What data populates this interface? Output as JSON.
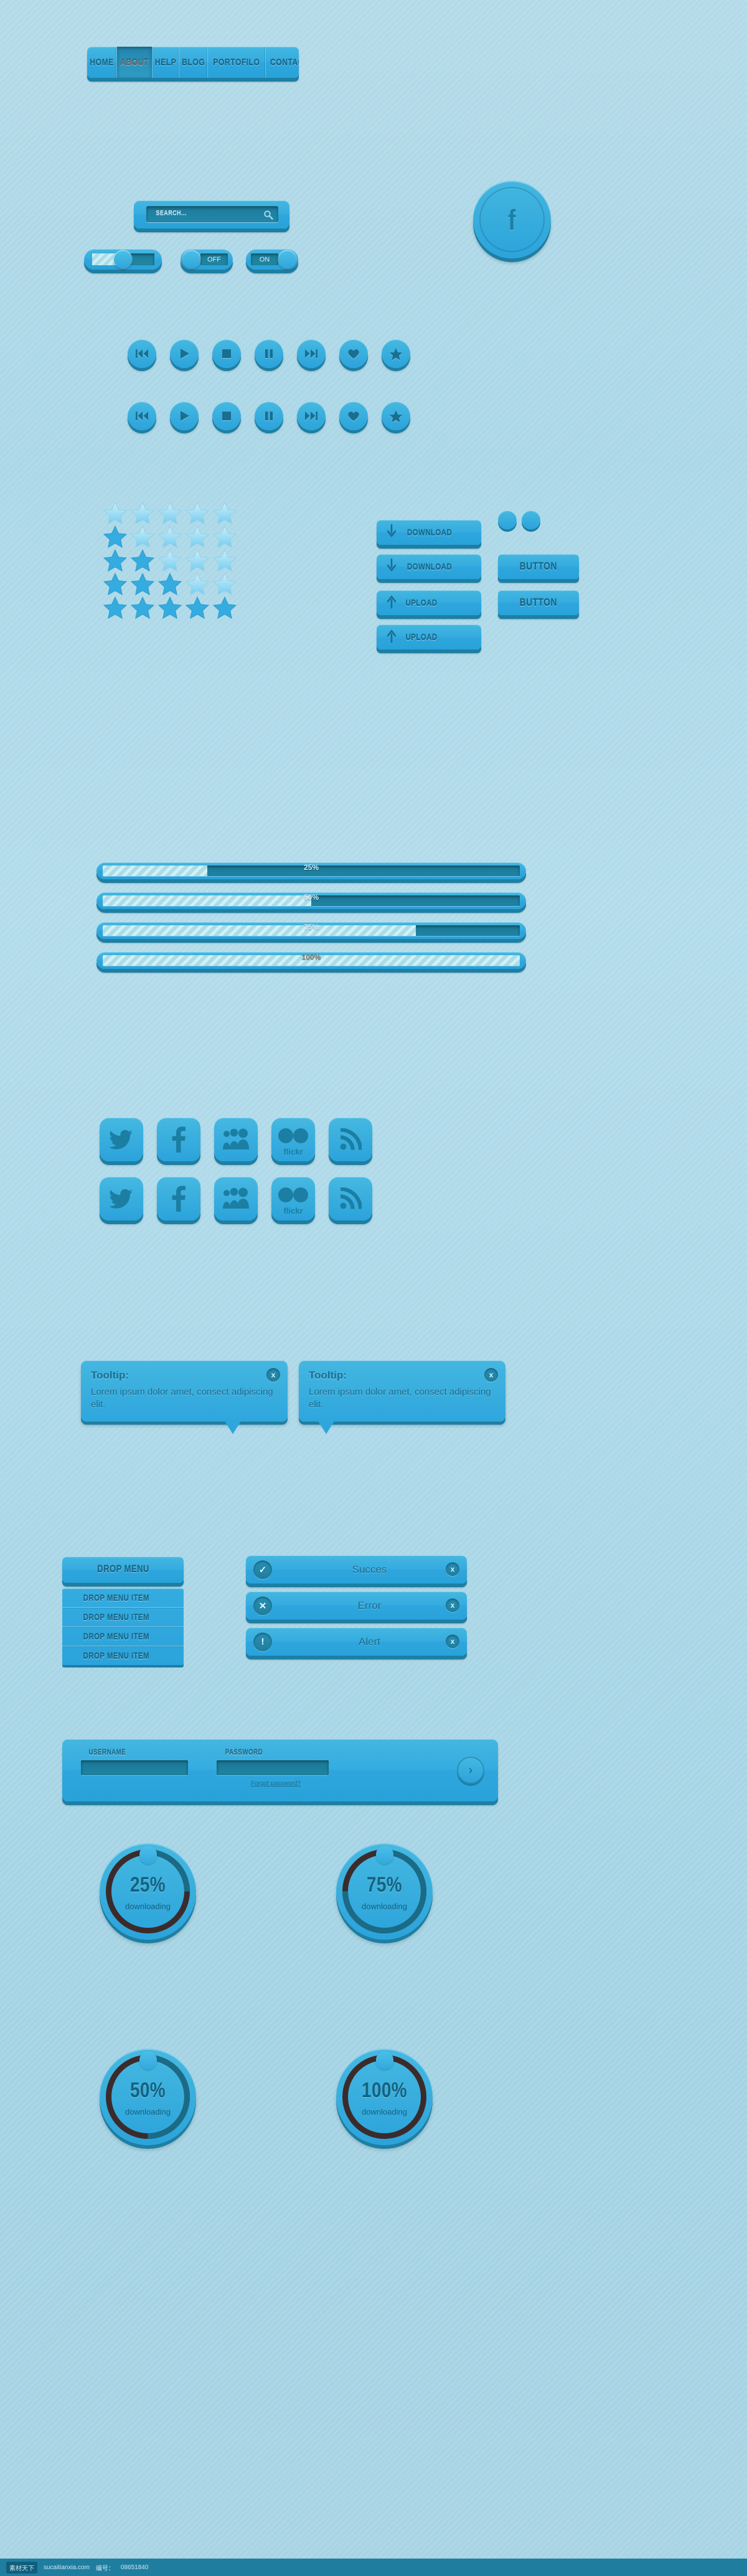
{
  "palette": {
    "bg": "#a8d4e4",
    "chip": "#35ace0",
    "chip_dark": "#1d7fa4",
    "ink": "#17688a",
    "inset": "#1d7c9e",
    "stripe_light": "#d3f0f5",
    "arc_dark": "#3c2b2b",
    "arc_blue": "#1f6b85"
  },
  "nav": {
    "items": [
      {
        "label": "HOME",
        "active": false
      },
      {
        "label": "ABOUT",
        "active": true
      },
      {
        "label": "HELP",
        "active": false
      },
      {
        "label": "BLOG",
        "active": false
      },
      {
        "label": "PORTOFILO",
        "active": false
      },
      {
        "label": "CONTACT",
        "active": false
      }
    ]
  },
  "search": {
    "placeholder": "SEARCH...",
    "icon": "search-icon"
  },
  "logo": {
    "glyph": "f",
    "name": "brand-circle"
  },
  "toggles": {
    "slider_state": "half",
    "off_label": "OFF",
    "on_label": "ON"
  },
  "media_buttons": [
    {
      "name": "previous-button",
      "icon": "rewind-icon"
    },
    {
      "name": "play-button",
      "icon": "play-icon"
    },
    {
      "name": "stop-button",
      "icon": "stop-icon"
    },
    {
      "name": "pause-button",
      "icon": "pause-icon"
    },
    {
      "name": "next-button",
      "icon": "fast-forward-icon"
    },
    {
      "name": "favorite-button",
      "icon": "heart-icon"
    },
    {
      "name": "rate-button",
      "icon": "star-icon"
    }
  ],
  "stars": {
    "rows": 5,
    "cols": 5,
    "note": "star rating glyph grid"
  },
  "action_buttons": [
    {
      "label": "DOWNLOAD",
      "icon": "arrow-down-icon",
      "name": "download-button-1"
    },
    {
      "label": "DOWNLOAD",
      "icon": "arrow-down-icon",
      "name": "download-button-2"
    },
    {
      "label": "UPLOAD",
      "icon": "arrow-up-icon",
      "name": "upload-button-1"
    },
    {
      "label": "UPLOAD",
      "icon": "arrow-up-icon",
      "name": "upload-button-2"
    }
  ],
  "plain_buttons": [
    {
      "label": "BUTTON"
    },
    {
      "label": "BUTTON"
    }
  ],
  "progress_bars": [
    {
      "label": "25%",
      "value": 25
    },
    {
      "label": "50%",
      "value": 50
    },
    {
      "label": "75%",
      "value": 75
    },
    {
      "label": "100%",
      "value": 100
    }
  ],
  "social": [
    {
      "name": "twitter-icon",
      "label": "twitter"
    },
    {
      "name": "facebook-icon",
      "label": "facebook"
    },
    {
      "name": "myspace-icon",
      "label": "myspace"
    },
    {
      "name": "flickr-icon",
      "label": "flickr"
    },
    {
      "name": "rss-icon",
      "label": "rss"
    }
  ],
  "tooltips": [
    {
      "title": "Tooltip:",
      "body": "Lorem ipsum dolor amet, consect adipiscing elit.",
      "close": "x"
    },
    {
      "title": "Tooltip:",
      "body": "Lorem ipsum dolor amet, consect adipiscing elit.",
      "close": "x"
    }
  ],
  "drop_menu": {
    "header": "DROP MENU",
    "items": [
      "DROP MENU ITEM",
      "DROP MENU ITEM",
      "DROP MENU ITEM",
      "DROP MENU ITEM"
    ]
  },
  "notifications": [
    {
      "type": "success",
      "icon": "check-icon",
      "message": "Succes",
      "close": "x"
    },
    {
      "type": "error",
      "icon": "cross-icon",
      "message": "Error",
      "close": "x"
    },
    {
      "type": "alert",
      "icon": "exclamation-icon",
      "message": "Alert",
      "close": "x"
    }
  ],
  "login": {
    "username_label": "USERNAME",
    "password_label": "PASSWORD",
    "forgot_label": "Forgot password?",
    "submit_icon": "›",
    "username_value": "",
    "password_value": ""
  },
  "circular_progress": [
    {
      "value": "25%",
      "percent": 25,
      "caption": "downloading"
    },
    {
      "value": "75%",
      "percent": 75,
      "caption": "downloading"
    },
    {
      "value": "50%",
      "percent": 50,
      "caption": "downloading"
    },
    {
      "value": "100%",
      "percent": 100,
      "caption": "downloading"
    }
  ],
  "footer": {
    "badge": "素材天下",
    "site": "sucaitianxia.com",
    "code_label": "编号：",
    "code_value": "08651840"
  }
}
